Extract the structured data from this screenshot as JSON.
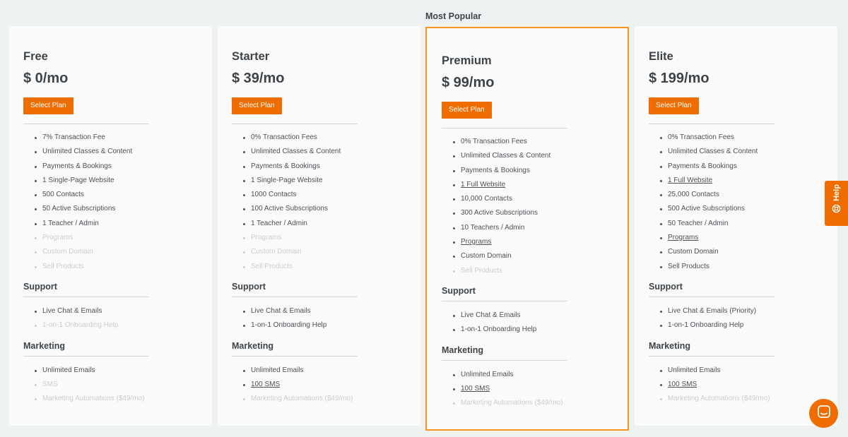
{
  "most_popular_label": "Most Popular",
  "select_label": "Select Plan",
  "help_label": "Help",
  "colors": {
    "accent": "#ef6c00",
    "highlight_border": "#f7951d",
    "background": "#eef1f2"
  },
  "plans": [
    {
      "name": "Free",
      "price": "$ 0/mo",
      "features": [
        {
          "text": "7% Transaction Fee",
          "state": "on"
        },
        {
          "text": "Unlimited Classes & Content",
          "state": "on"
        },
        {
          "text": "Payments & Bookings",
          "state": "on"
        },
        {
          "text": "1 Single-Page Website",
          "state": "on"
        },
        {
          "text": "500 Contacts",
          "state": "on"
        },
        {
          "text": "50 Active Subscriptions",
          "state": "on"
        },
        {
          "text": "1 Teacher / Admin",
          "state": "on"
        },
        {
          "text": "Programs",
          "state": "off"
        },
        {
          "text": "Custom Domain",
          "state": "off"
        },
        {
          "text": "Sell Products",
          "state": "off"
        }
      ],
      "support_title": "Support",
      "support": [
        {
          "text": "Live Chat & Emails",
          "state": "on"
        },
        {
          "text": "1-on-1 Onboarding Help",
          "state": "off"
        }
      ],
      "marketing_title": "Marketing",
      "marketing": [
        {
          "text": "Unlimited Emails",
          "state": "on"
        },
        {
          "text": "SMS",
          "state": "off"
        },
        {
          "text": "Marketing Automations ($49/mo)",
          "state": "off"
        }
      ]
    },
    {
      "name": "Starter",
      "price": "$ 39/mo",
      "features": [
        {
          "text": "0% Transaction Fees",
          "state": "on"
        },
        {
          "text": "Unlimited Classes & Content",
          "state": "on"
        },
        {
          "text": "Payments & Bookings",
          "state": "on"
        },
        {
          "text": "1 Single-Page Website",
          "state": "on"
        },
        {
          "text": "1000 Contacts",
          "state": "on"
        },
        {
          "text": "100 Active Subscriptions",
          "state": "on"
        },
        {
          "text": "1 Teacher / Admin",
          "state": "on"
        },
        {
          "text": "Programs",
          "state": "off"
        },
        {
          "text": "Custom Domain",
          "state": "off"
        },
        {
          "text": "Sell Products",
          "state": "off"
        }
      ],
      "support_title": "Support",
      "support": [
        {
          "text": "Live Chat & Emails",
          "state": "on"
        },
        {
          "text": "1-on-1 Onboarding Help",
          "state": "on"
        }
      ],
      "marketing_title": "Marketing",
      "marketing": [
        {
          "text": "Unlimited Emails",
          "state": "on"
        },
        {
          "text": "100 SMS",
          "state": "link"
        },
        {
          "text": "Marketing Automations ($49/mo)",
          "state": "off"
        }
      ]
    },
    {
      "name": "Premium",
      "price": "$ 99/mo",
      "highlight": true,
      "features": [
        {
          "text": "0% Transaction Fees",
          "state": "on"
        },
        {
          "text": "Unlimited Classes & Content",
          "state": "on"
        },
        {
          "text": "Payments & Bookings",
          "state": "on"
        },
        {
          "text": "1 Full Website",
          "state": "link"
        },
        {
          "text": "10,000 Contacts",
          "state": "on"
        },
        {
          "text": "300 Active Subscriptions",
          "state": "on"
        },
        {
          "text": "10 Teachers / Admin",
          "state": "on"
        },
        {
          "text": "Programs",
          "state": "link"
        },
        {
          "text": "Custom Domain",
          "state": "on"
        },
        {
          "text": "Sell Products",
          "state": "off"
        }
      ],
      "support_title": "Support",
      "support": [
        {
          "text": "Live Chat & Emails",
          "state": "on"
        },
        {
          "text": "1-on-1 Onboarding Help",
          "state": "on"
        }
      ],
      "marketing_title": "Marketing",
      "marketing": [
        {
          "text": "Unlimited Emails",
          "state": "on"
        },
        {
          "text": "100 SMS",
          "state": "link"
        },
        {
          "text": "Marketing Automations ($49/mo)",
          "state": "off"
        }
      ]
    },
    {
      "name": "Elite",
      "price": "$ 199/mo",
      "features": [
        {
          "text": "0% Transaction Fees",
          "state": "on"
        },
        {
          "text": "Unlimited Classes & Content",
          "state": "on"
        },
        {
          "text": "Payments & Bookings",
          "state": "on"
        },
        {
          "text": "1 Full Website",
          "state": "link"
        },
        {
          "text": "25,000 Contacts",
          "state": "on"
        },
        {
          "text": "500 Active Subscriptions",
          "state": "on"
        },
        {
          "text": "50 Teacher / Admin",
          "state": "on"
        },
        {
          "text": "Programs",
          "state": "link"
        },
        {
          "text": "Custom Domain",
          "state": "on"
        },
        {
          "text": "Sell Products",
          "state": "on"
        }
      ],
      "support_title": "Support",
      "support": [
        {
          "text": "Live Chat & Emails (Priority)",
          "state": "on"
        },
        {
          "text": "1-on-1 Onboarding Help",
          "state": "on"
        }
      ],
      "marketing_title": "Marketing",
      "marketing": [
        {
          "text": "Unlimited Emails",
          "state": "on"
        },
        {
          "text": "100 SMS",
          "state": "link"
        },
        {
          "text": "Marketing Automations ($49/mo)",
          "state": "off"
        }
      ]
    }
  ]
}
